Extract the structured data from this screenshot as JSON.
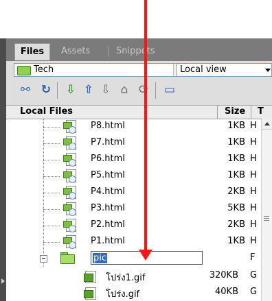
{
  "tabs": [
    {
      "label": "Files"
    },
    {
      "label": "Assets"
    },
    {
      "label": "Snippets"
    }
  ],
  "toolbar": {
    "site_select_value": "Tech",
    "view_select_value": "Local view",
    "icons": [
      "connect-icon",
      "refresh-icon",
      "get-icon",
      "put-icon",
      "check-out-icon",
      "check-in-icon",
      "synchronize-icon",
      "expand-icon"
    ]
  },
  "list_header": {
    "local_files": "Local Files",
    "size": "Size",
    "type": "T"
  },
  "files": [
    {
      "name": "P8.html",
      "size": "1KB",
      "type": "H"
    },
    {
      "name": "P7.html",
      "size": "1KB",
      "type": "H"
    },
    {
      "name": "P6.html",
      "size": "1KB",
      "type": "H"
    },
    {
      "name": "P5.html",
      "size": "1KB",
      "type": "H"
    },
    {
      "name": "P4.html",
      "size": "2KB",
      "type": "H"
    },
    {
      "name": "P3.html",
      "size": "5KB",
      "type": "H"
    },
    {
      "name": "P2.html",
      "size": "2KB",
      "type": "H"
    },
    {
      "name": "P1.html",
      "size": "1KB",
      "type": "H"
    }
  ],
  "folder": {
    "name_edit_value": "pic",
    "type": "F"
  },
  "children": [
    {
      "name": "โปร่ง1.gif",
      "size": "320KB",
      "type": "G"
    },
    {
      "name": "โปร่ง.gif",
      "size": "40KB",
      "type": "G"
    }
  ],
  "colors": {
    "annotation_arrow": "#ff1414",
    "selection": "#316ac5"
  }
}
